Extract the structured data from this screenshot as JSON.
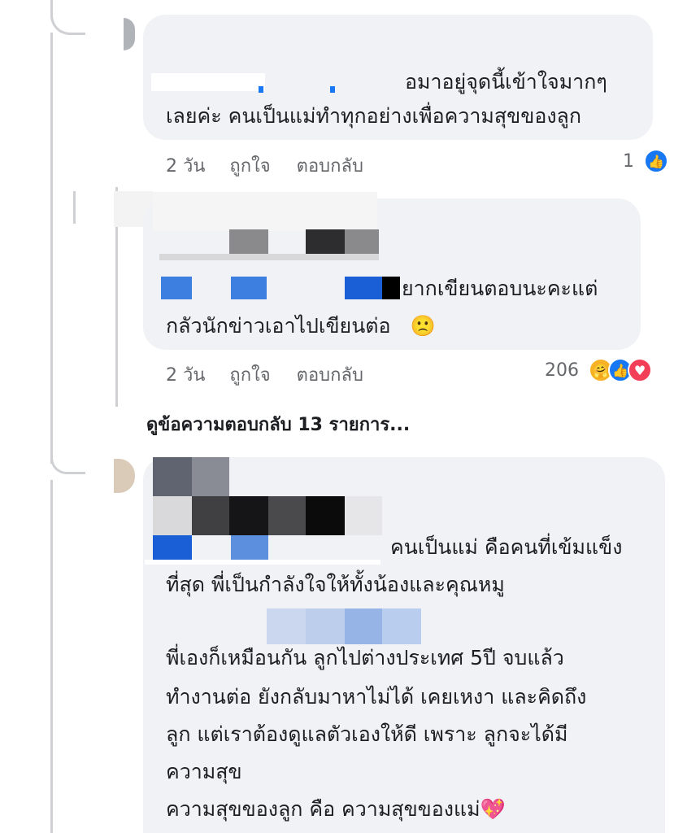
{
  "comments": [
    {
      "lines": [
        "อมาอยู่จุดนี้เข้าใจมากๆ",
        "เลยค่ะ คนเป็นแม่ทำทุกอย่างเพื่อความสุขของลูก"
      ],
      "time": "2 วัน",
      "like_label": "ถูกใจ",
      "reply_label": "ตอบกลับ",
      "reaction_count": "1",
      "reactions": [
        "like-icon"
      ]
    },
    {
      "lines": [
        "ยากเขียนตอบนะคะแต่",
        "กลัวนักข่าวเอาไปเขียนต่อ"
      ],
      "emoji": "🙁",
      "time": "2 วัน",
      "like_label": "ถูกใจ",
      "reply_label": "ตอบกลับ",
      "reaction_count": "206",
      "reactions": [
        "care-icon",
        "like-icon",
        "love-icon"
      ]
    },
    {
      "lines": [
        "คนเป็นแม่ คือคนที่เข้มแข็ง",
        "ที่สุด พี่เป็นกำลังใจให้ทั้งน้องและคุณหมู",
        "พี่เองก็เหมือนกัน ลูกไปต่างประเทศ 5ปี จบแล้ว",
        "ทำงานต่อ ยังกลับมาหาไม่ได้ เคยเหงา และคิดถึง",
        "ลูก  แต่เราต้องดูแลตัวเองให้ดี เพราะ ลูกจะได้มี",
        "ความสุข",
        "ความสุขของลูก คือ ความสุขของแม่"
      ],
      "emoji": "💖"
    }
  ],
  "view_replies": "ดูข้อความตอบกลับ 13 รายการ...",
  "colors": {
    "bubble": "#f0f2f5",
    "like_blue": "#1877f2",
    "love_red": "#f33e58",
    "care_yellow": "#f7b125"
  }
}
